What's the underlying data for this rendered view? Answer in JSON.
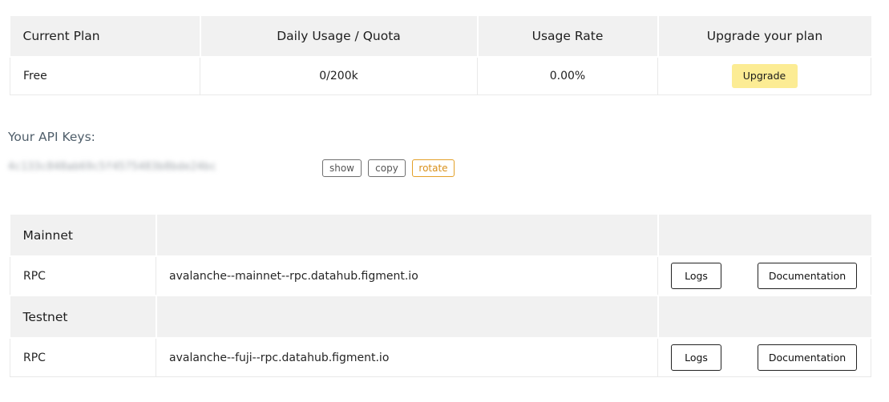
{
  "plan": {
    "headers": {
      "current_plan": "Current Plan",
      "daily_usage": "Daily Usage / Quota",
      "usage_rate": "Usage Rate",
      "upgrade": "Upgrade your plan"
    },
    "row": {
      "plan": "Free",
      "usage": "0/200k",
      "rate": "0.00%",
      "upgrade_button": "Upgrade"
    },
    "upgrade_button_color": "#fcec94"
  },
  "api_keys": {
    "label": "Your API Keys:",
    "key_masked": "4c133c848ab69c5f4575483b8bde24bc",
    "show_button": "show",
    "copy_button": "copy",
    "rotate_button": "rotate",
    "rotate_color": "#e3a028"
  },
  "networks": [
    {
      "name": "Mainnet",
      "rows": [
        {
          "type": "RPC",
          "url": "avalanche--mainnet--rpc.datahub.figment.io",
          "logs_button": "Logs",
          "docs_button": "Documentation"
        }
      ]
    },
    {
      "name": "Testnet",
      "rows": [
        {
          "type": "RPC",
          "url": "avalanche--fuji--rpc.datahub.figment.io",
          "logs_button": "Logs",
          "docs_button": "Documentation"
        }
      ]
    }
  ]
}
